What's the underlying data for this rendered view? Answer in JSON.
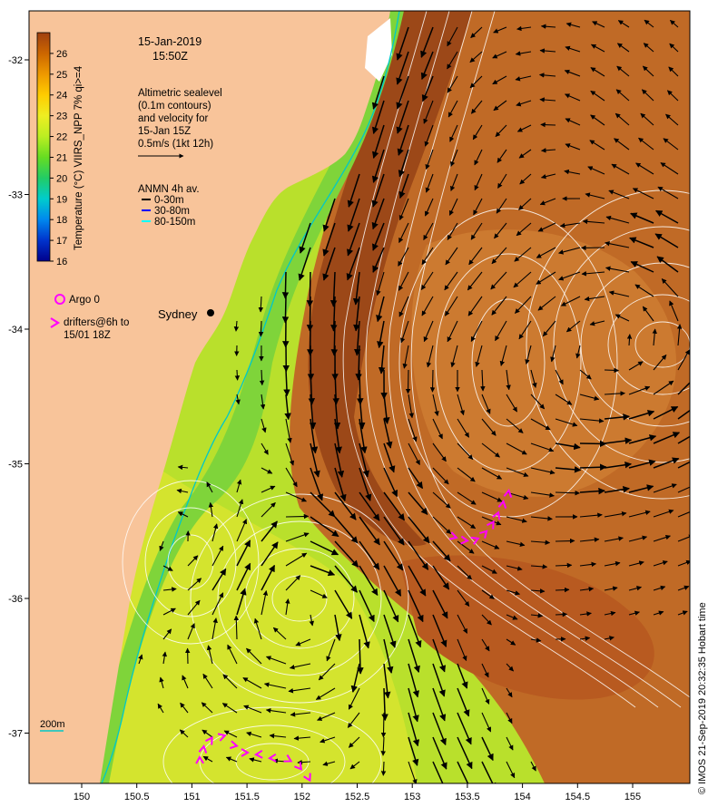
{
  "header": {
    "date": "15-Jan-2019",
    "time": "15:50Z"
  },
  "altimetry": {
    "lines": [
      "Altimetric sealevel",
      "(0.1m contours)",
      "and velocity for",
      "15-Jan 15Z",
      "0.5m/s (1kt 12h)"
    ]
  },
  "anmn": {
    "title": "ANMN 4h av.",
    "depths": [
      {
        "label": "0-30m",
        "color": "#000000"
      },
      {
        "label": "30-80m",
        "color": "#0000ff"
      },
      {
        "label": "80-150m",
        "color": "#00ffff"
      }
    ]
  },
  "argo": {
    "label": "Argo 0",
    "color": "#ff00ff"
  },
  "drifters": {
    "label_line1": "drifters@6h to",
    "label_line2": "15/01 18Z",
    "color": "#ff00ff"
  },
  "city": {
    "name": "Sydney"
  },
  "contour_label": "200m",
  "colorbar": {
    "title": "Temperature (°C) VIIRS_NPP 7% qi>=4",
    "min": 16,
    "max": 27,
    "ticks": [
      16,
      17,
      18,
      19,
      20,
      21,
      22,
      23,
      24,
      25,
      26
    ],
    "colors": [
      "#00008b",
      "#0033cc",
      "#0088ee",
      "#00cccc",
      "#22cc66",
      "#66dd22",
      "#bbee22",
      "#eeee22",
      "#ffcc00",
      "#ee9900",
      "#cc6600",
      "#a04010"
    ]
  },
  "axes": {
    "x_ticks": [
      "150",
      "150.5",
      "151",
      "151.5",
      "152",
      "152.5",
      "153",
      "153.5",
      "154",
      "154.5",
      "155"
    ],
    "y_ticks": [
      "-32",
      "-33",
      "-34",
      "-35",
      "-36",
      "-37"
    ]
  },
  "footer": {
    "credit": "© IMOS 21-Sep-2019 20:32:35 Hobart time"
  },
  "colors": {
    "land": "#f8c49a",
    "warm_current": "#9c4818",
    "warm_core": "#c06a26",
    "shelf_water": "#9ade2c",
    "cool_water": "#c8e230",
    "coastal": "#7fd43a",
    "vector": "#000000",
    "contour": "#ffffff",
    "shelf_contour": "#00c8c8"
  }
}
